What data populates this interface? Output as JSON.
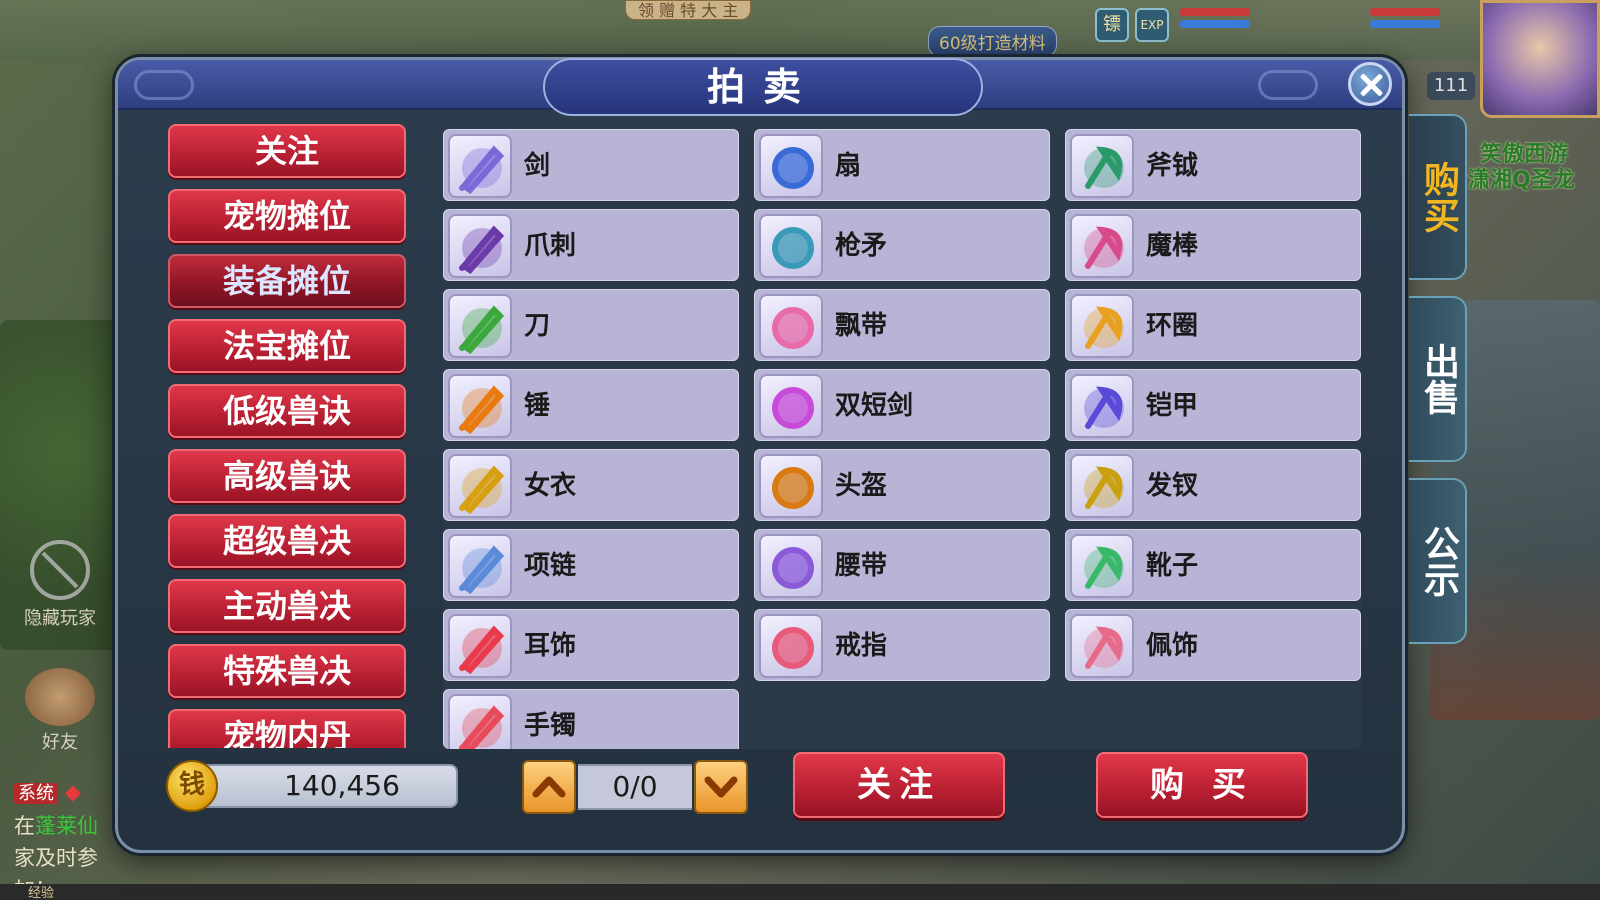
{
  "background": {
    "top_banner": "领 赠 特 大 主",
    "material_badge": "60级打造材料",
    "hud_icon_a": "镖",
    "hud_icon_b": "EXP",
    "level": "111",
    "player_name_1": "笑傲西游",
    "player_name_2": "潇湘Q圣龙",
    "hide_players_label": "隐藏玩家",
    "friends_label": "好友",
    "chat_system_tag": "系统",
    "chat_line_1a": "在",
    "chat_line_1b": "蓬莱仙",
    "chat_line_2": "家及时参加！",
    "exp_label": "经验"
  },
  "dialog": {
    "title": "拍卖",
    "close_icon": "close-icon"
  },
  "categories": [
    {
      "label": "关注",
      "selected": false
    },
    {
      "label": "宠物摊位",
      "selected": false
    },
    {
      "label": "装备摊位",
      "selected": true
    },
    {
      "label": "法宝摊位",
      "selected": false
    },
    {
      "label": "低级兽诀",
      "selected": false
    },
    {
      "label": "高级兽诀",
      "selected": false
    },
    {
      "label": "超级兽决",
      "selected": false
    },
    {
      "label": "主动兽决",
      "selected": false
    },
    {
      "label": "特殊兽决",
      "selected": false
    },
    {
      "label": "宠物内丹",
      "selected": false
    }
  ],
  "items": [
    {
      "name": "剑",
      "icon": "sword-icon",
      "color": "#7a6ad8"
    },
    {
      "name": "扇",
      "icon": "fan-icon",
      "color": "#3a6ad8"
    },
    {
      "name": "斧钺",
      "icon": "axe-icon",
      "color": "#2a9a6a"
    },
    {
      "name": "爪刺",
      "icon": "claw-icon",
      "color": "#6a3aa8"
    },
    {
      "name": "枪矛",
      "icon": "spear-icon",
      "color": "#3a9ab8"
    },
    {
      "name": "魔棒",
      "icon": "wand-icon",
      "color": "#d84a8a"
    },
    {
      "name": "刀",
      "icon": "blade-icon",
      "color": "#3aa83a"
    },
    {
      "name": "飘带",
      "icon": "ribbon-icon",
      "color": "#e86aa8"
    },
    {
      "name": "环圈",
      "icon": "ring-blade-icon",
      "color": "#e8a020"
    },
    {
      "name": "锤",
      "icon": "hammer-icon",
      "color": "#e87a10"
    },
    {
      "name": "双短剑",
      "icon": "twin-daggers-icon",
      "color": "#c84ad8"
    },
    {
      "name": "铠甲",
      "icon": "armor-icon",
      "color": "#5a4ad8"
    },
    {
      "name": "女衣",
      "icon": "robe-icon",
      "color": "#d8a010"
    },
    {
      "name": "头盔",
      "icon": "helmet-icon",
      "color": "#d87a10"
    },
    {
      "name": "发钗",
      "icon": "hairpin-icon",
      "color": "#c8a010"
    },
    {
      "name": "项链",
      "icon": "necklace-icon",
      "color": "#5a8ad8"
    },
    {
      "name": "腰带",
      "icon": "belt-icon",
      "color": "#8a5ad8"
    },
    {
      "name": "靴子",
      "icon": "boots-icon",
      "color": "#3ab86a"
    },
    {
      "name": "耳饰",
      "icon": "earring-icon",
      "color": "#e83a4a"
    },
    {
      "name": "戒指",
      "icon": "ring-icon",
      "color": "#e85a7a"
    },
    {
      "name": "佩饰",
      "icon": "pendant-icon",
      "color": "#e86a8a"
    },
    {
      "name": "手镯",
      "icon": "bracelet-icon",
      "color": "#e84a5a"
    }
  ],
  "side_tabs": [
    {
      "label": "购买",
      "active": true
    },
    {
      "label": "出售",
      "active": false
    },
    {
      "label": "公示",
      "active": false
    }
  ],
  "footer": {
    "coin_glyph": "钱",
    "money": "140,456",
    "page_text": "0/0",
    "follow_button": "关注",
    "buy_button": "购 买"
  }
}
